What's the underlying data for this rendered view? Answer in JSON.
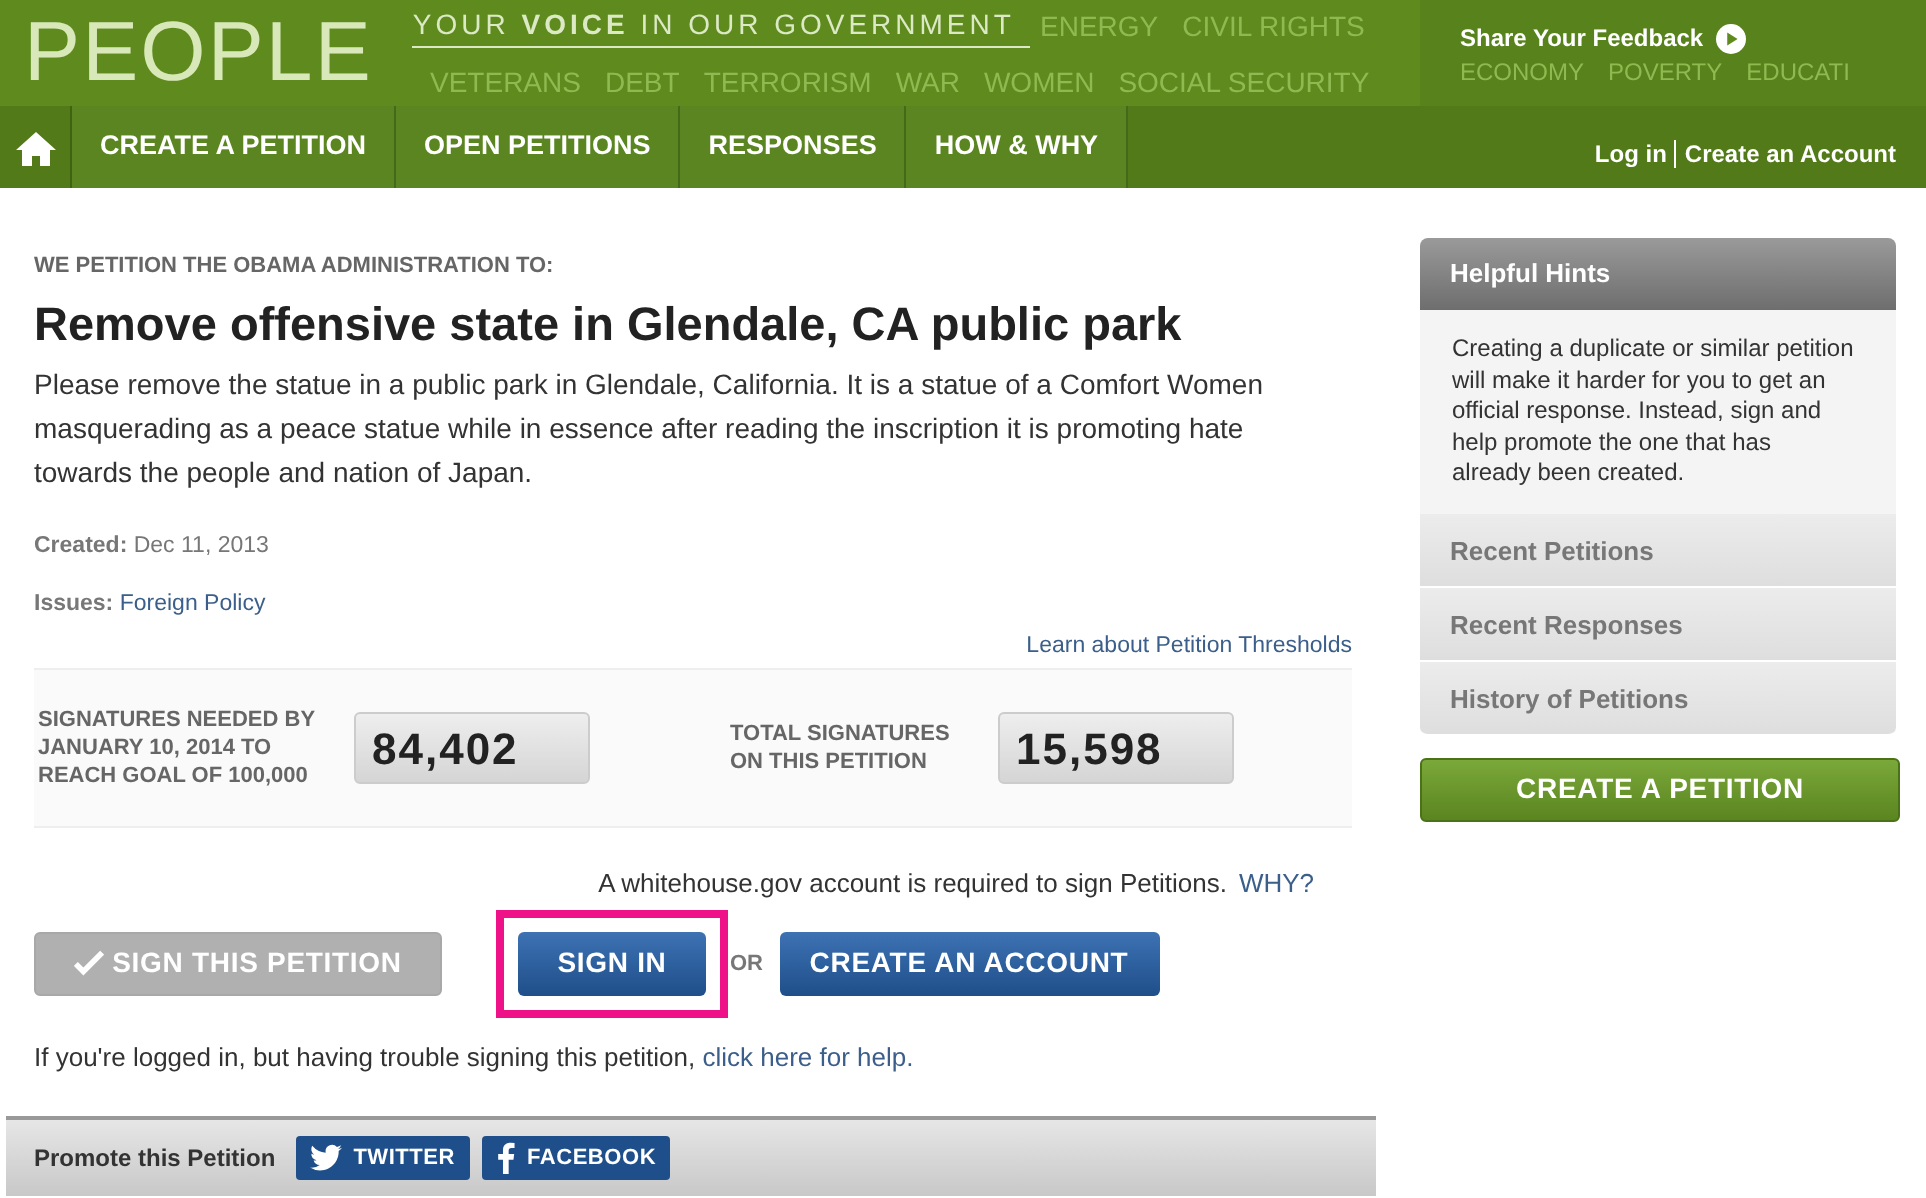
{
  "header": {
    "logo": "PEOPLE",
    "tagline_before": "YOUR",
    "tagline_bold": "VOICE",
    "tagline_after": "IN OUR GOVERNMENT",
    "feedback": "Share Your Feedback",
    "background_words": [
      "ENERGY",
      "CIVIL RIGHTS",
      "VETERANS",
      "DEBT",
      "TERRORISM",
      "WAR",
      "WOMEN",
      "SOCIAL SECURITY",
      "ECONOMY",
      "POVERTY",
      "EDUCATI"
    ]
  },
  "nav": {
    "items": [
      {
        "label": "CREATE A PETITION",
        "selected": false
      },
      {
        "label": "OPEN PETITIONS",
        "selected": false
      },
      {
        "label": "RESPONSES",
        "selected": false
      },
      {
        "label": "HOW & WHY",
        "selected": false
      }
    ],
    "login": "Log in",
    "create_account": "Create an Account"
  },
  "petition": {
    "kicker": "WE PETITION THE OBAMA ADMINISTRATION TO:",
    "title": "Remove offensive state in Glendale, CA public park",
    "body": "Please remove the statue in a public park in Glendale, California. It is a statue of a Comfort Women masquerading as a peace statue while in essence after reading the inscription it is promoting hate towards the people and nation of Japan.",
    "created_label": "Created:",
    "created": "Dec 11, 2013",
    "issues_label": "Issues:",
    "issues": "Foreign Policy"
  },
  "thresholds_link": "Learn about Petition Thresholds",
  "counters": [
    {
      "label": "SIGNATURES NEEDED BY JANUARY 10, 2014 TO REACH GOAL OF 100,000",
      "value": "84,402"
    },
    {
      "label": "TOTAL SIGNATURES ON THIS PETITION",
      "value": "15,598"
    }
  ],
  "sign": {
    "notice": "A whitehouse.gov account is required to sign Petitions.",
    "why": "WHY?",
    "sign_button": "SIGN THIS PETITION",
    "sign_disabled": true,
    "sign_in": "SIGN IN",
    "sign_in_highlighted": true,
    "or": "OR",
    "create_account": "CREATE AN ACCOUNT",
    "help_text": "If you're logged in, but having trouble signing this petition,",
    "help_link": "click here for help."
  },
  "promote": {
    "label": "Promote this Petition",
    "buttons": [
      {
        "kind": "twitter",
        "label": "TWITTER"
      },
      {
        "kind": "facebook",
        "label": "FACEBOOK"
      }
    ]
  },
  "sidebar": {
    "hints_title": "Helpful Hints",
    "hints_text": "Creating a duplicate or similar petition will make it harder for you to get an official response. Instead, sign and help promote the one that has already been created.",
    "items": [
      "Recent Petitions",
      "Recent Responses",
      "History of Petitions"
    ],
    "create_button": "CREATE A PETITION"
  }
}
